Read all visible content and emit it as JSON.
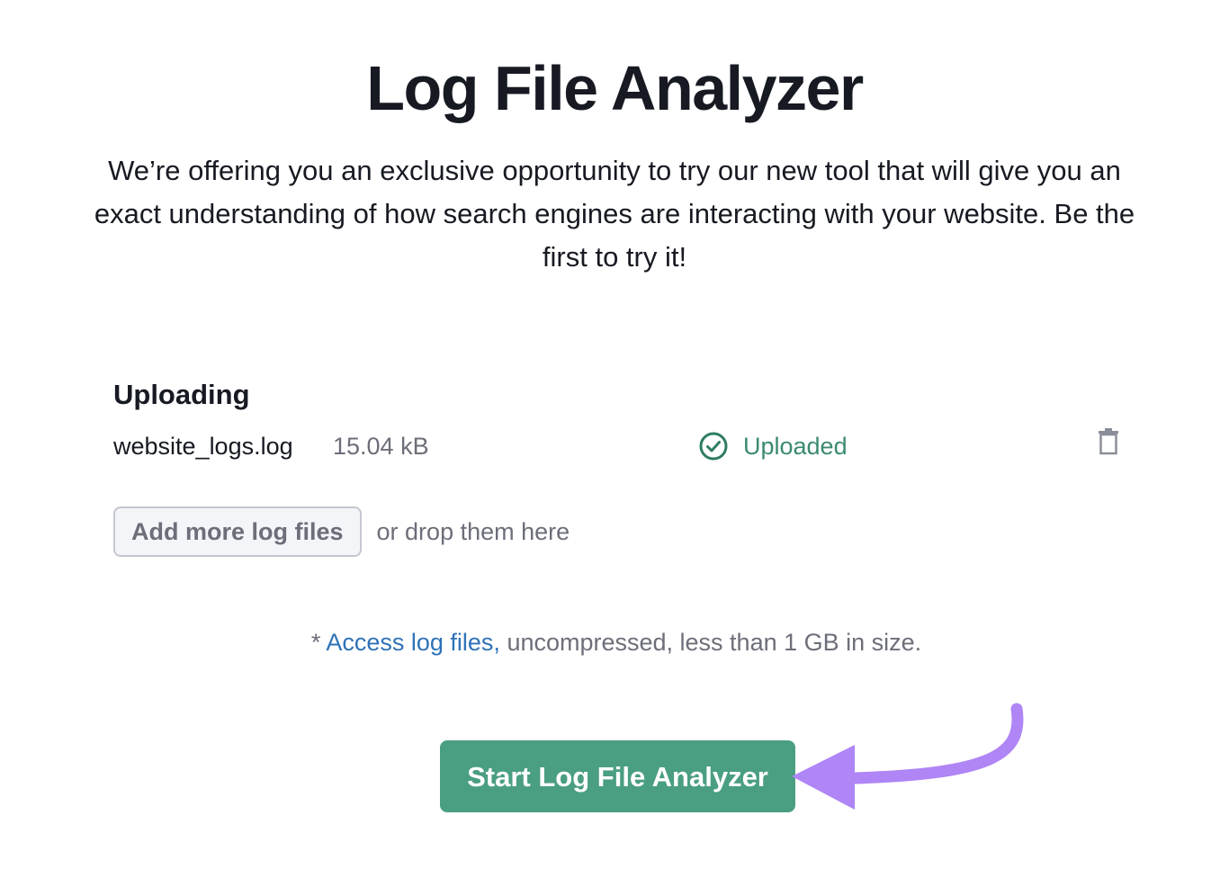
{
  "page": {
    "title": "Log File Analyzer",
    "intro": "We’re offering you an exclusive opportunity to try our new tool that will give you an exact understanding of how search engines are interacting with your website. Be the first to try it!"
  },
  "upload": {
    "heading": "Uploading",
    "file": {
      "name": "website_logs.log",
      "size": "15.04 kB",
      "status": "Uploaded",
      "status_icon": "check-circle-icon",
      "delete_icon": "trash-icon"
    },
    "add_button_label": "Add more log files",
    "drop_text": "or drop them here"
  },
  "note": {
    "prefix": "* ",
    "link_text": "Access log files,",
    "suffix": " uncompressed, less than 1 GB in size."
  },
  "actions": {
    "start_label": "Start Log File Analyzer"
  },
  "colors": {
    "primary_green": "#4a9e82",
    "status_green": "#3b8a70",
    "link_blue": "#2e72b8",
    "annotation_arrow": "#b085f5"
  }
}
